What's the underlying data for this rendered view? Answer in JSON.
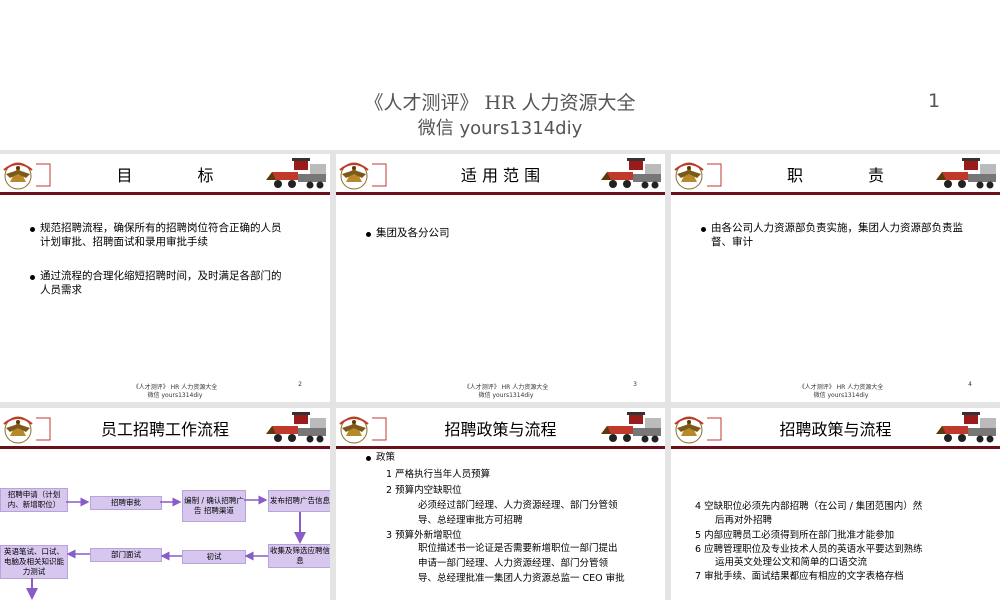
{
  "header": {
    "title": "《人才测评》 HR 人力资源大全",
    "subtitle": "微信 yours1314diy",
    "page_number": "1"
  },
  "slides": {
    "s2": {
      "title": "目 标",
      "bullets": [
        "规范招聘流程，确保所有的招聘岗位符合正确的人员计划审批、招聘面试和录用审批手续",
        "通过流程的合理化缩短招聘时间，及时满足各部门的人员需求"
      ],
      "footer": "《人才测评》 HR 人力资源大全",
      "footer2": "微信 yours1314diy",
      "page": "2"
    },
    "s3": {
      "title": "适 用 范 围",
      "bullets": [
        "集团及各分公司"
      ],
      "footer": "《人才测评》 HR 人力资源大全",
      "footer2": "微信 yours1314diy",
      "page": "3"
    },
    "s4": {
      "title": "职 责",
      "bullets": [
        "由各公司人力资源部负责实施，集团人力资源部负责监督、审计"
      ],
      "footer": "《人才测评》 HR 人力资源大全",
      "footer2": "微信 yours1314diy",
      "page": "4"
    },
    "s5": {
      "title": "员工招聘工作流程",
      "flow": {
        "b1": "招聘申请（计划内、新增职位）",
        "b2": "招聘审批",
        "b3": "编制 / 确认招聘广告 招聘渠道",
        "b4": "发布招聘广告信息",
        "b5": "英语笔试、口试、电脑及相关知识能力测试",
        "b6": "部门面试",
        "b7": "初试",
        "b8": "收集及筛选应聘信息"
      }
    },
    "s6": {
      "title": "招聘政策与流程",
      "heading": "政策",
      "items": [
        "1 严格执行当年人员预算",
        "2 预算内空缺职位",
        "必须经过部门经理、人力资源经理、部门分管领",
        "导、总经理审批方可招聘",
        "3 预算外新增职位",
        "职位描述书一论证是否需要新增职位一部门提出",
        "申请一部门经理、人力资源经理、部门分管领",
        "导、总经理批准一集团人力资源总监一 CEO 审批"
      ]
    },
    "s7": {
      "title": "招聘政策与流程",
      "items": [
        "4 空缺职位必须先内部招聘（在公司 / 集团范围内）然",
        "后再对外招聘",
        "5 内部应聘员工必须得到所在部门批准才能参加",
        "6 应聘管理职位及专业技术人员的英语水平要达到熟练",
        "运用英文处理公文和简单的口语交流",
        "7 审批手续、面试结果都应有相应的文字表格存档"
      ]
    }
  },
  "colors": {
    "divider": "#6b0f1a",
    "flow_box": "#d7c7ee",
    "flow_arrow": "#8a5cc8"
  }
}
